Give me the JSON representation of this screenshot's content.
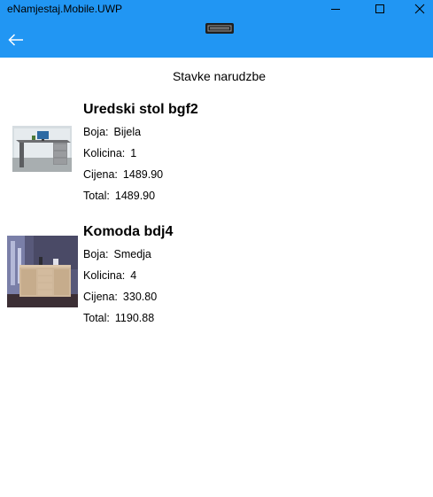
{
  "window": {
    "title": "eNamjestaj.Mobile.UWP",
    "accent_color": "#2196f3"
  },
  "page": {
    "title": "Stavke narudzbe"
  },
  "items": [
    {
      "name": "Uredski stol bgf2",
      "color_label": "Boja:",
      "color_value": "Bijela",
      "qty_label": "Kolicina:",
      "qty_value": "1",
      "price_label": "Cijena:",
      "price_value": "1489.90",
      "total_label": "Total:",
      "total_value": "1489.90",
      "image": "office-desk-photo"
    },
    {
      "name": "Komoda bdj4",
      "color_label": "Boja:",
      "color_value": "Smedja",
      "qty_label": "Kolicina:",
      "qty_value": "4",
      "price_label": "Cijena:",
      "price_value": "330.80",
      "total_label": "Total:",
      "total_value": "1190.88",
      "image": "dresser-photo"
    }
  ]
}
